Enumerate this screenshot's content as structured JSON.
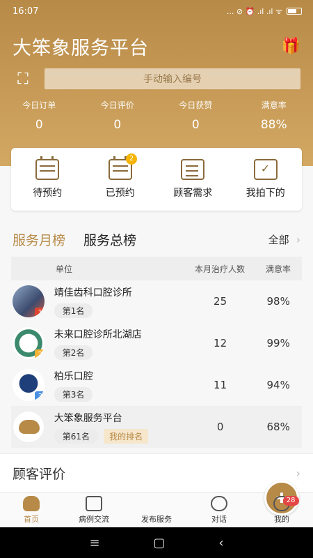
{
  "status_bar": {
    "time": "16:07",
    "indicators": "... ⊘ ⏰ .ıl .ıl ᯤ"
  },
  "header": {
    "title": "大笨象服务平台",
    "gift_icon": "gift-icon",
    "scan_icon": "scan-icon",
    "search_placeholder": "手动输入编号"
  },
  "stats": [
    {
      "label": "今日订单",
      "value": "0"
    },
    {
      "label": "今日评价",
      "value": "0"
    },
    {
      "label": "今日获赞",
      "value": "0"
    },
    {
      "label": "满意率",
      "value": "88%"
    }
  ],
  "quick_actions": [
    {
      "label": "待预约",
      "icon": "calendar-edit-icon"
    },
    {
      "label": "已预约",
      "icon": "calendar-clock-icon",
      "badge": "2"
    },
    {
      "label": "顾客需求",
      "icon": "request-icon"
    },
    {
      "label": "我拍下的",
      "icon": "photo-check-icon"
    }
  ],
  "ranking": {
    "tabs": [
      "服务月榜",
      "服务总榜"
    ],
    "all_label": "全部",
    "columns": {
      "unit": "单位",
      "count": "本月治疗人数",
      "rate": "满意率"
    },
    "rows": [
      {
        "name": "靖佳齿科口腔诊所",
        "rank": "第1名",
        "count": "25",
        "rate": "98%",
        "medal": "1",
        "medal_color": "#e0452f"
      },
      {
        "name": "未来口腔诊所北湖店",
        "rank": "第2名",
        "count": "12",
        "rate": "99%",
        "medal": "2",
        "medal_color": "#f2b233"
      },
      {
        "name": "柏乐口腔",
        "rank": "第3名",
        "count": "11",
        "rate": "94%",
        "medal": "3",
        "medal_color": "#4a90e2"
      }
    ],
    "mine": {
      "name": "大笨象服务平台",
      "rank": "第61名",
      "tag": "我的排名",
      "count": "0",
      "rate": "68%"
    }
  },
  "reviews": {
    "title": "顾客评价"
  },
  "tabbar": {
    "home": "首页",
    "cases": "病例交流",
    "publish": "发布服务",
    "chat": "对话",
    "me": "我的",
    "me_badge": "28"
  },
  "nav": {
    "menu": "≡",
    "home": "▢",
    "back": "‹"
  }
}
